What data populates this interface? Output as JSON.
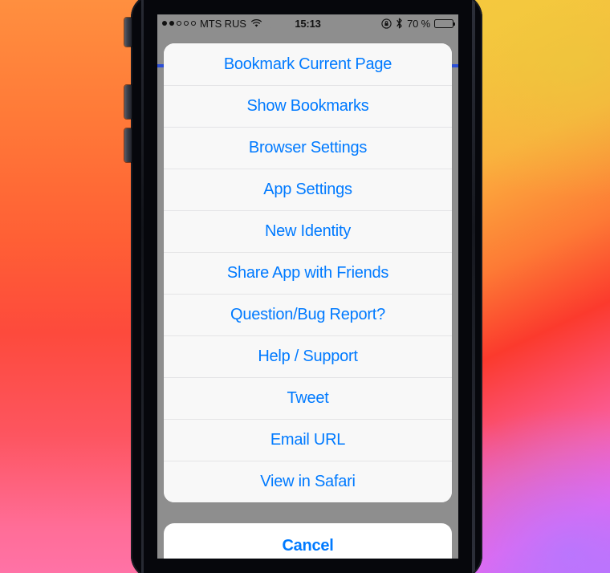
{
  "status_bar": {
    "signal_dots_filled": 2,
    "signal_dots_empty": 3,
    "carrier": "MTS RUS",
    "wifi_icon": "wifi-icon",
    "activity_icon": "activity-spinner-icon",
    "time": "15:13",
    "rotation_lock_icon": "rotation-lock-icon",
    "bluetooth_icon": "bluetooth-icon",
    "battery_percent": "70 %",
    "battery_level": 70,
    "battery_icon": "battery-icon"
  },
  "action_sheet": {
    "items": [
      {
        "label": "Bookmark Current Page",
        "name": "sheet-item-bookmark-current-page"
      },
      {
        "label": "Show Bookmarks",
        "name": "sheet-item-show-bookmarks"
      },
      {
        "label": "Browser Settings",
        "name": "sheet-item-browser-settings"
      },
      {
        "label": "App Settings",
        "name": "sheet-item-app-settings"
      },
      {
        "label": "New Identity",
        "name": "sheet-item-new-identity"
      },
      {
        "label": "Share App with Friends",
        "name": "sheet-item-share-app-with-friends"
      },
      {
        "label": "Question/Bug Report?",
        "name": "sheet-item-question-bug-report"
      },
      {
        "label": "Help / Support",
        "name": "sheet-item-help-support"
      },
      {
        "label": "Tweet",
        "name": "sheet-item-tweet"
      },
      {
        "label": "Email URL",
        "name": "sheet-item-email-url"
      },
      {
        "label": "View in Safari",
        "name": "sheet-item-view-in-safari"
      }
    ],
    "cancel_label": "Cancel"
  },
  "colors": {
    "accent_blue": "#007aff",
    "progress_blue": "#2c4fd8",
    "sheet_background": "#f8f8f8",
    "cancel_background": "#ffffff",
    "screen_backdrop": "#8e8e8e",
    "separator": "#e4e4e6"
  }
}
